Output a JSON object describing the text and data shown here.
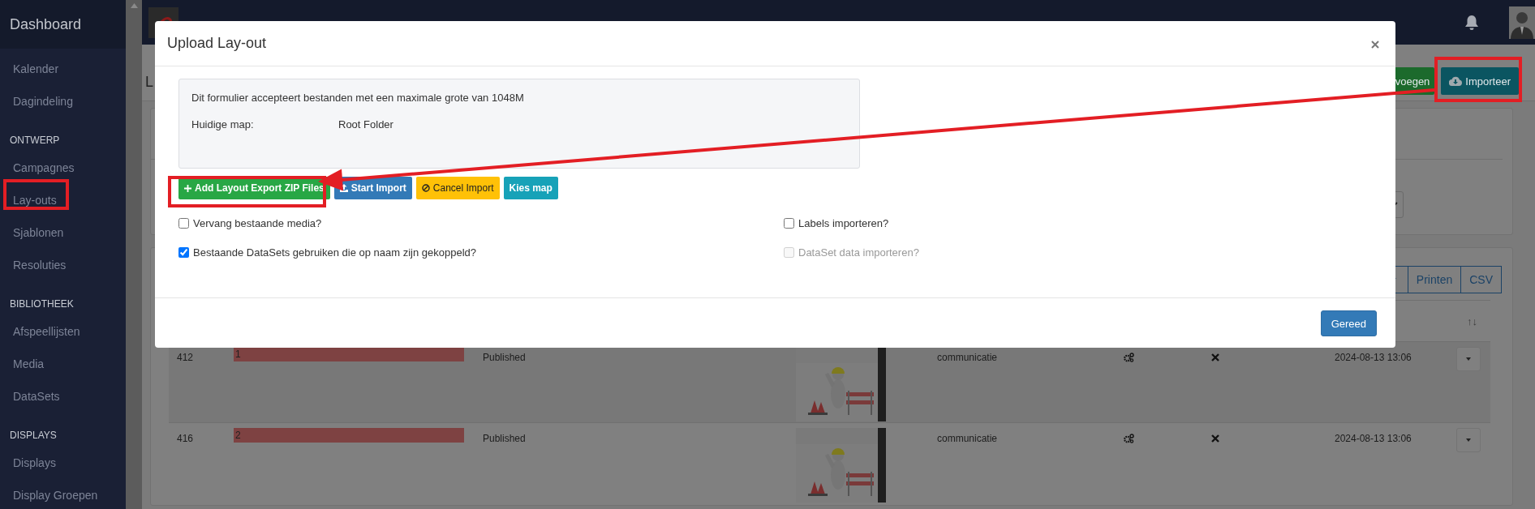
{
  "sidebar": {
    "title": "Dashboard",
    "sections": [
      {
        "items": [
          "Kalender",
          "Dagindeling"
        ]
      },
      {
        "heading": "ONTWERP",
        "items": [
          "Campagnes",
          "Lay-outs",
          "Sjablonen",
          "Resoluties"
        ]
      },
      {
        "heading": "BIBLIOTHEEK",
        "items": [
          "Afspeellijsten",
          "Media",
          "DataSets"
        ]
      },
      {
        "heading": "DISPLAYS",
        "items": [
          "Displays",
          "Display Groepen"
        ]
      }
    ]
  },
  "page": {
    "title": "L",
    "actions": [
      {
        "label": "voegen",
        "kind": "add"
      },
      {
        "label": "Importeer",
        "kind": "import"
      }
    ]
  },
  "table_tools": [
    "Printen",
    "CSV"
  ],
  "table": {
    "sort_mark": "↑↓",
    "rows": [
      {
        "id": "412",
        "name": "1",
        "status": "Published",
        "owner": "communicatie",
        "modified": "2024-08-13 13:06"
      },
      {
        "id": "416",
        "name": "2",
        "status": "Published",
        "owner": "communicatie",
        "modified": "2024-08-13 13:06"
      }
    ]
  },
  "modal": {
    "title": "Upload Lay-out",
    "info": {
      "text": "Dit formulier accepteert bestanden met een maximale grote van 1048M",
      "folder_label": "Huidige map:",
      "folder_value": "Root Folder"
    },
    "buttons": [
      {
        "label": "Add Layout Export ZIP Files",
        "kind": "add"
      },
      {
        "label": "Start Import",
        "kind": "upload"
      },
      {
        "label": "Cancel Import",
        "kind": "cancel"
      },
      {
        "label": "Kies map",
        "kind": "folder"
      }
    ],
    "options": [
      {
        "label": "Vervang bestaande media?",
        "checked": false,
        "disabled": false
      },
      {
        "label": "Labels importeren?",
        "checked": false,
        "disabled": false
      },
      {
        "label": "Bestaande DataSets gebruiken die op naam zijn gekoppeld?",
        "checked": true,
        "disabled": false
      },
      {
        "label": "DataSet data importeren?",
        "checked": false,
        "disabled": true
      }
    ],
    "footer_button": "Gereed"
  }
}
